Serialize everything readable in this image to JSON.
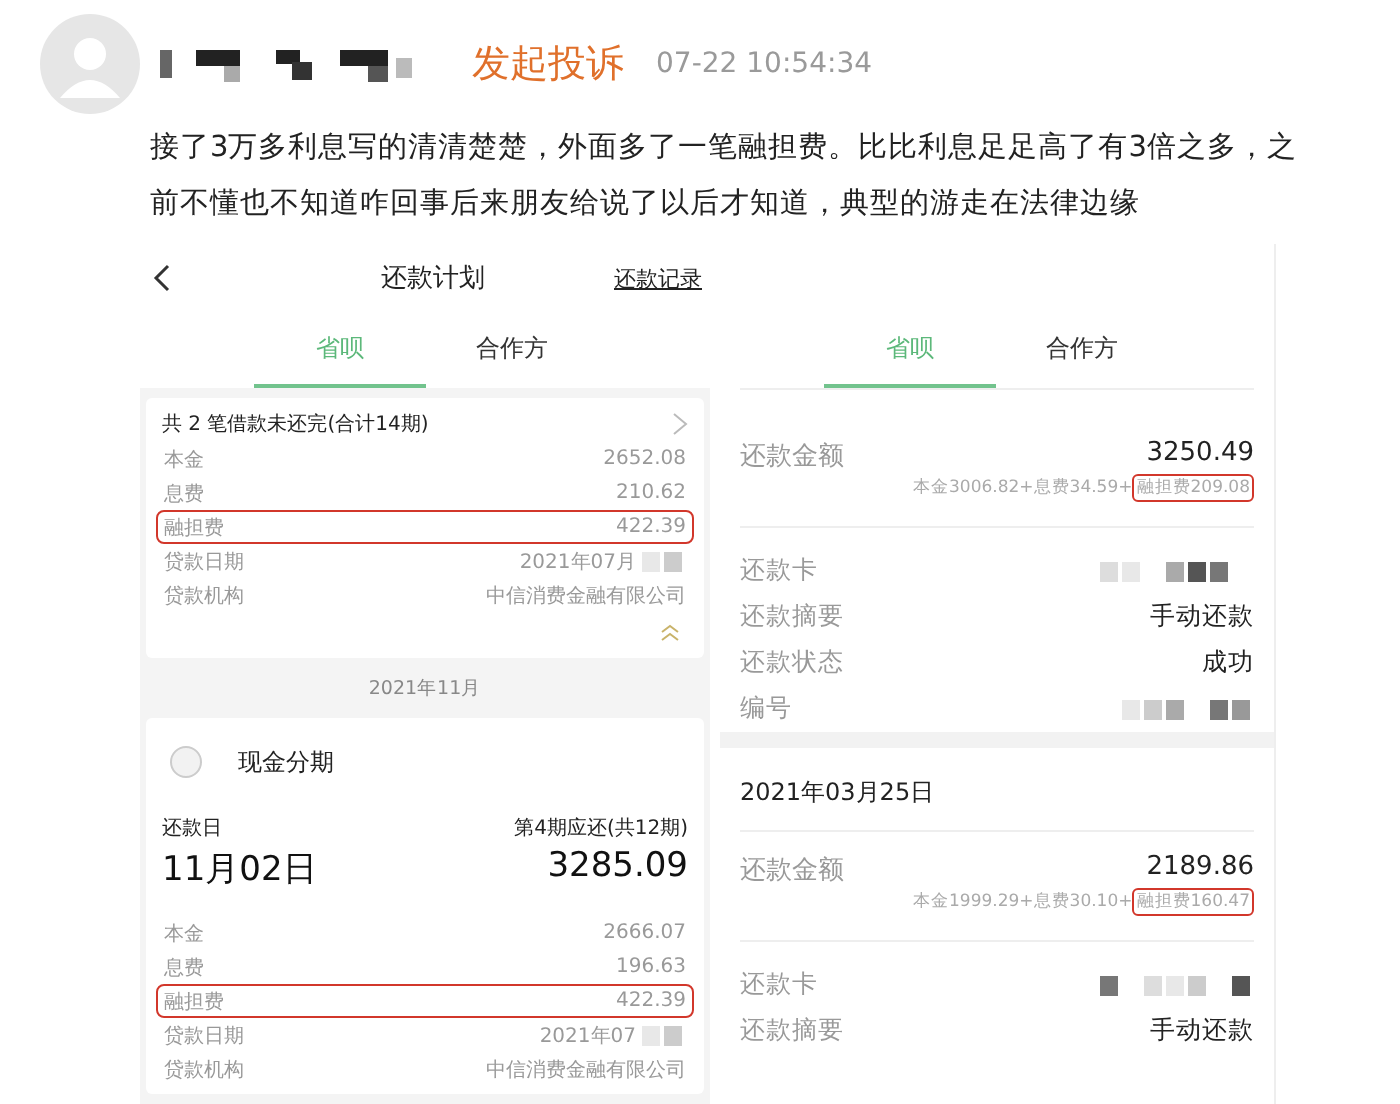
{
  "post": {
    "action": "发起投诉",
    "time": "07-22 10:54:34",
    "text": "接了3万多利息写的清清楚楚，外面多了一笔融担费。比比利息足足高了有3倍之多，之前不懂也不知道咋回事后来朋友给说了以后才知道，典型的游走在法律边缘"
  },
  "left_screen": {
    "title": "还款计划",
    "link": "还款记录",
    "tabs": [
      {
        "label": "省呗",
        "selected": true
      },
      {
        "label": "合作方",
        "selected": false
      }
    ],
    "summary_card": {
      "heading": "共 2 笔借款未还完(合计14期)",
      "rows": [
        {
          "label": "本金",
          "value": "2652.08",
          "masked": false,
          "highlighted": false
        },
        {
          "label": "息费",
          "value": "210.62",
          "masked": false,
          "highlighted": false
        },
        {
          "label": "融担费",
          "value": "422.39",
          "masked": false,
          "highlighted": true
        },
        {
          "label": "贷款日期",
          "value": "2021年07月",
          "masked": true,
          "highlighted": false
        },
        {
          "label": "贷款机构",
          "value": "中信消费金融有限公司",
          "masked": false,
          "highlighted": false
        }
      ]
    },
    "month": "2021年11月",
    "plan_card": {
      "name": "现金分期",
      "checked": false,
      "due_label": "还款日",
      "period_label": "第4期应还(共12期)",
      "due_date": "11月02日",
      "amount": "3285.09",
      "rows": [
        {
          "label": "本金",
          "value": "2666.07",
          "masked": false,
          "highlighted": false
        },
        {
          "label": "息费",
          "value": "196.63",
          "masked": false,
          "highlighted": false
        },
        {
          "label": "融担费",
          "value": "422.39",
          "masked": false,
          "highlighted": true
        },
        {
          "label": "贷款日期",
          "value": "2021年07",
          "masked": true,
          "highlighted": false
        },
        {
          "label": "贷款机构",
          "value": "中信消费金融有限公司",
          "masked": false,
          "highlighted": false
        }
      ]
    }
  },
  "right_screen": {
    "tabs": [
      {
        "label": "省呗",
        "selected": true
      },
      {
        "label": "合作方",
        "selected": false
      }
    ],
    "records": [
      {
        "amount_label": "还款金额",
        "amount": "3250.49",
        "breakdown": "本金3006.82+息费34.59+",
        "breakdown_highlight": "融担费209.08",
        "rows": [
          {
            "label": "还款卡",
            "masked": true
          },
          {
            "label": "还款摘要",
            "value": "手动还款",
            "masked": false
          },
          {
            "label": "还款状态",
            "value": "成功",
            "masked": false
          },
          {
            "label": "编号",
            "masked": true
          }
        ]
      },
      {
        "date": "2021年03月25日",
        "amount_label": "还款金额",
        "amount": "2189.86",
        "breakdown": "本金1999.29+息费30.10+",
        "breakdown_highlight": "融担费160.47",
        "rows": [
          {
            "label": "还款卡",
            "masked": true
          },
          {
            "label": "还款摘要",
            "value": "手动还款",
            "masked": false
          }
        ]
      }
    ]
  }
}
